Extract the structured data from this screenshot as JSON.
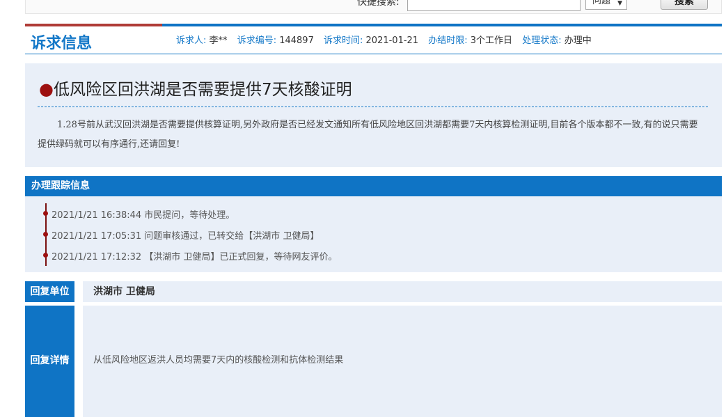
{
  "top_search": {
    "label": "快捷搜索:",
    "input_value": "",
    "select_value": "问题",
    "button_label": "搜索"
  },
  "header": {
    "title": "诉求信息",
    "fields": [
      {
        "key": "诉求人:",
        "value": "李**"
      },
      {
        "key": "诉求编号:",
        "value": "144897"
      },
      {
        "key": "诉求时间:",
        "value": "2021-01-21"
      },
      {
        "key": "办结时限:",
        "value": "3个工作日"
      },
      {
        "key": "处理状态:",
        "value": "办理中"
      }
    ]
  },
  "question": {
    "bullet": "●",
    "title": "低风险区回洪湖是否需要提供7天核酸证明",
    "body": "1.28号前从武汉回洪湖是否需要提供核算证明,另外政府是否已经发文通知所有低风险地区回洪湖都需要7天内核算检测证明,目前各个版本都不一致,有的说只需要提供绿码就可以有序通行,还请回复!"
  },
  "tracking": {
    "header": "办理跟踪信息",
    "items": [
      "2021/1/21 16:38:44 市民提问，等待处理。",
      "2021/1/21 17:05:31 问题审核通过，已转交给【洪湖市 卫健局】",
      "2021/1/21 17:12:32 【洪湖市 卫健局】已正式回复，等待网友评价。"
    ]
  },
  "reply": {
    "unit_label": "回复单位",
    "unit_value": "洪湖市  卫健局",
    "detail_label": "回复详情",
    "detail_value": "从低风险地区返洪人员均需要7天内的核酸检测和抗体检测结果"
  },
  "colors": {
    "accent_blue": "#0f74c5",
    "accent_red": "#b03b37",
    "panel_bg": "#e9eff8"
  }
}
